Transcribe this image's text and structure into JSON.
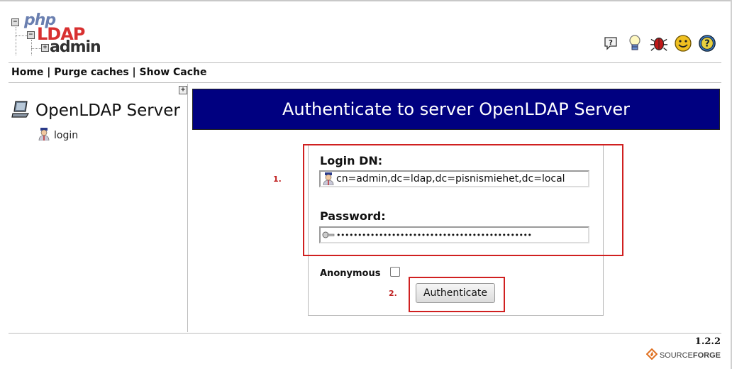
{
  "logo": {
    "php": "php",
    "ldap": "LDAP",
    "admin": "admin"
  },
  "header_icons": [
    "help-icon",
    "light-bulb-icon",
    "bug-icon",
    "smiley-icon",
    "question-icon"
  ],
  "menu": {
    "home": "Home",
    "sep1": "|",
    "purge": "Purge caches",
    "sep2": "|",
    "show_cache": "Show Cache"
  },
  "sidebar": {
    "expand_symbol": "+",
    "server_name": "OpenLDAP Server",
    "login_label": "login"
  },
  "main": {
    "title": "Authenticate to server OpenLDAP Server",
    "annotation_1": "1.",
    "annotation_2": "2.",
    "login_dn_label": "Login DN:",
    "login_dn_value": "cn=admin,dc=ldap,dc=pisnismiehet,dc=local",
    "password_label": "Password:",
    "password_value": "••••••••••••••••••••••••••••••••••••••••••••••",
    "anonymous_label": "Anonymous",
    "anonymous_checked": false,
    "authenticate_label": "Authenticate"
  },
  "footer": {
    "version": "1.2.2",
    "sf_source": "SOURCE",
    "sf_forge": "FORGE"
  },
  "colors": {
    "title_bg": "#000080",
    "annotation": "#d02020"
  }
}
